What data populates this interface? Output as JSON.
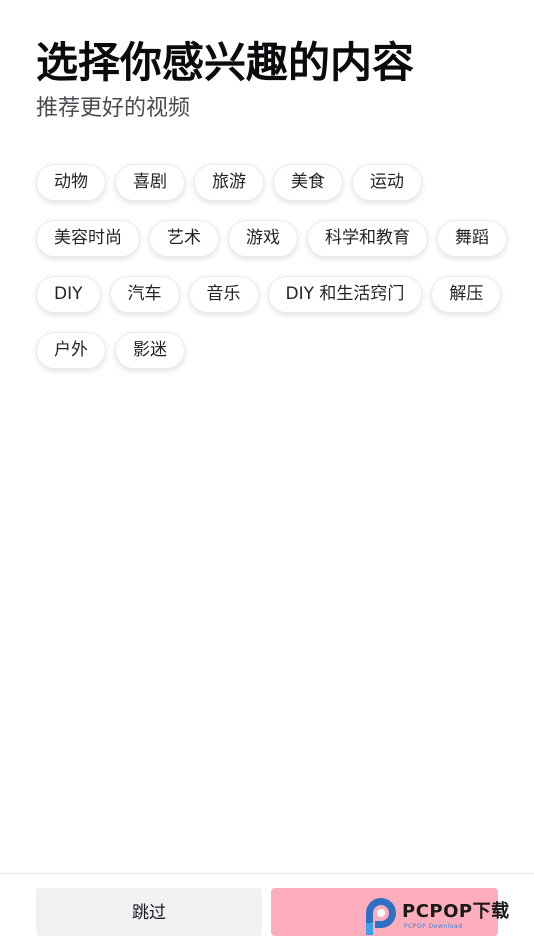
{
  "header": {
    "title": "选择你感兴趣的内容",
    "subtitle": "推荐更好的视频"
  },
  "tags": {
    "rows": [
      [
        "动物",
        "喜剧",
        "旅游",
        "美食",
        "运动"
      ],
      [
        "美容时尚",
        "艺术",
        "游戏",
        "科学和教育",
        "舞蹈"
      ],
      [
        "DIY",
        "汽车",
        "音乐",
        "DIY 和生活窍门",
        "解压"
      ],
      [
        "户外",
        "影迷"
      ]
    ]
  },
  "footer": {
    "skip_label": "跳过",
    "confirm_label": ""
  },
  "watermark": {
    "text": "PCPOP下载",
    "subtext": "PCPOP Download"
  },
  "colors": {
    "confirm_button": "#fdadbb",
    "skip_button": "#f1f1f2",
    "watermark_blue": "#3a7fd6"
  }
}
